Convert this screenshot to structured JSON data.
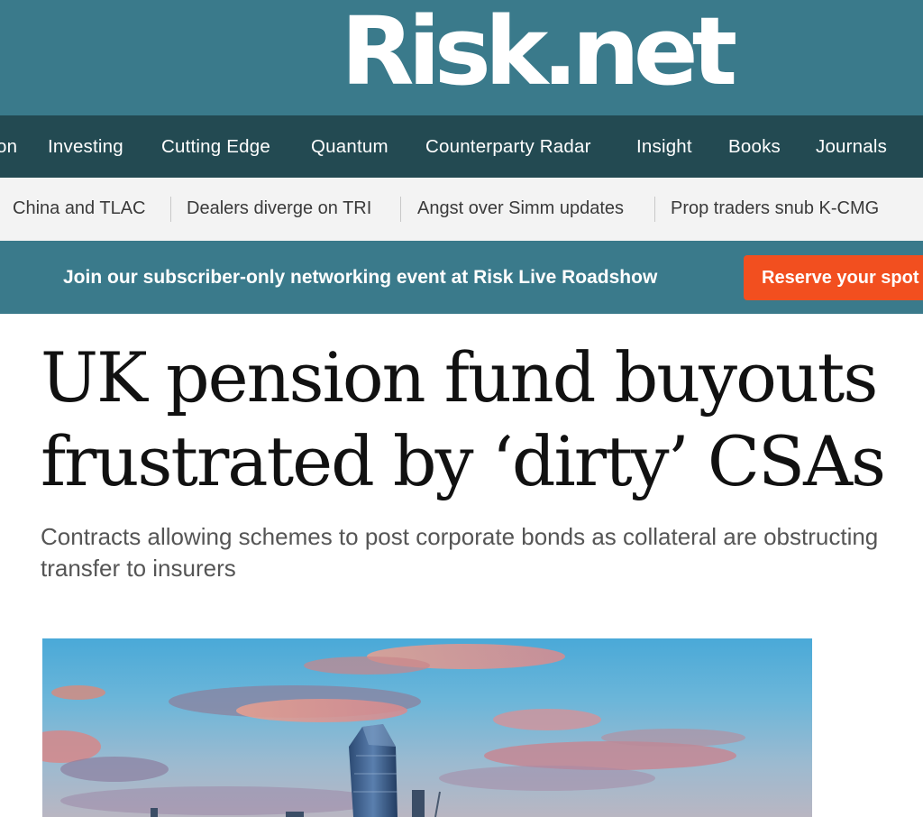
{
  "header": {
    "logo_text": "Risk.net",
    "background": "#3a7a8b"
  },
  "main_nav": {
    "items": [
      {
        "label": "on"
      },
      {
        "label": "Investing"
      },
      {
        "label": "Cutting Edge"
      },
      {
        "label": "Quantum"
      },
      {
        "label": "Counterparty Radar"
      },
      {
        "label": "Insight"
      },
      {
        "label": "Books"
      },
      {
        "label": "Journals"
      }
    ],
    "background": "#234a52"
  },
  "trending": {
    "items": [
      {
        "label": "China and TLAC"
      },
      {
        "label": "Dealers diverge on TRI"
      },
      {
        "label": "Angst over Simm updates"
      },
      {
        "label": "Prop traders snub K-CMG"
      }
    ]
  },
  "promo": {
    "text": "Join our subscriber-only networking event at Risk Live Roadshow",
    "button_label": "Reserve your spot",
    "button_color": "#f24f1f"
  },
  "article": {
    "headline_lines": [
      "UK pension fund buyouts",
      "frustrated by ‘dirty’ CSAs"
    ],
    "standfirst_lines": [
      "Contracts allowing schemes to post corporate bonds as collateral are obstructing",
      "transfer to insurers"
    ]
  },
  "hero": {
    "description_icon": "city-skyline-image"
  }
}
